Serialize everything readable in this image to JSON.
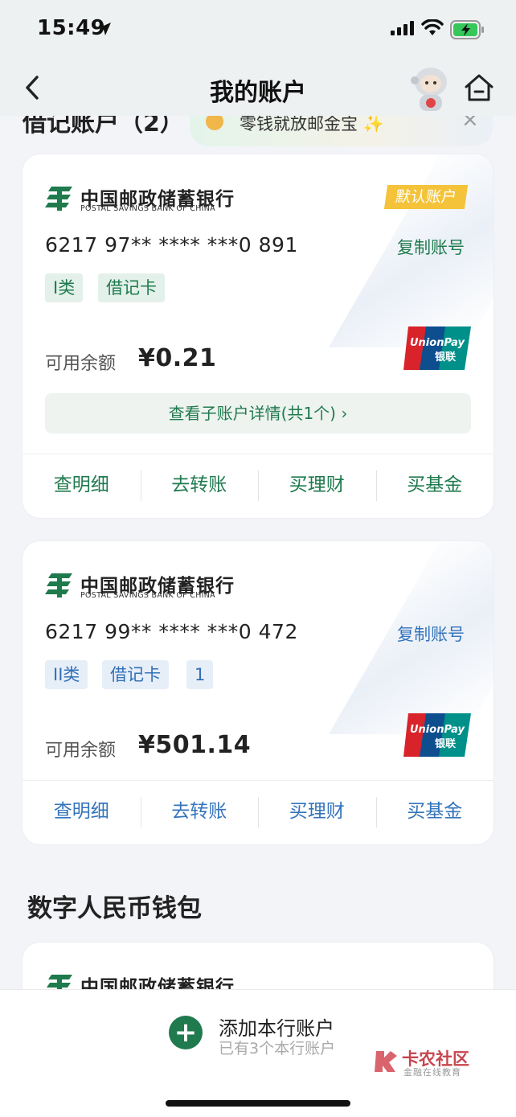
{
  "status": {
    "time": "15:49"
  },
  "nav": {
    "title": "我的账户"
  },
  "section_top": {
    "title": "借记账户（2）"
  },
  "promo": {
    "text": "零钱就放邮金宝 ✨",
    "close": "×"
  },
  "bank": {
    "name_cn": "中国邮政储蓄银行",
    "name_en": "POSTAL SAVINGS BANK OF CHINA"
  },
  "cards": [
    {
      "default_badge": "默认账户",
      "account_no": "6217 97** **** ***0 891",
      "copy_label": "复制账号",
      "tags": [
        "I类",
        "借记卡"
      ],
      "balance_label": "可用余额",
      "balance": "¥0.21",
      "sub_account_btn": "查看子账户详情(共1个) ›",
      "actions": [
        "查明细",
        "去转账",
        "买理财",
        "买基金"
      ]
    },
    {
      "account_no": "6217 99** **** ***0 472",
      "copy_label": "复制账号",
      "tags": [
        "II类",
        "借记卡",
        "1"
      ],
      "balance_label": "可用余额",
      "balance": "¥501.14",
      "actions": [
        "查明细",
        "去转账",
        "买理财",
        "买基金"
      ]
    }
  ],
  "section2": {
    "title": "数字人民币钱包"
  },
  "bottom": {
    "add_title": "添加本行账户",
    "add_sub": "已有3个本行账户",
    "add_symbol": "+"
  },
  "watermark": {
    "title": "卡农社区",
    "sub": "金融在线教育"
  },
  "colors": {
    "green": "#1f7a4d",
    "blue": "#3474bb",
    "badge": "#f4c33a"
  }
}
